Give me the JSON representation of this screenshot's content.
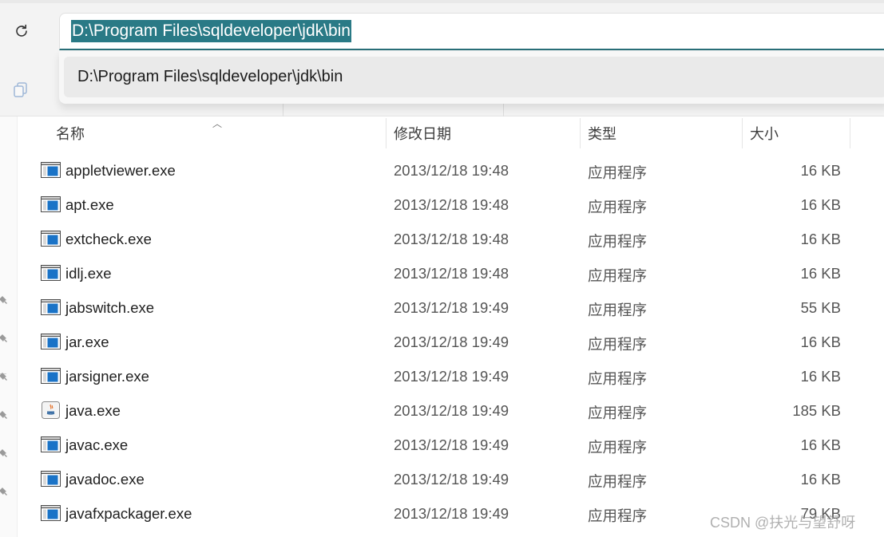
{
  "address_bar": {
    "value": "D:\\Program Files\\sqldeveloper\\jdk\\bin",
    "suggestion": "D:\\Program Files\\sqldeveloper\\jdk\\bin"
  },
  "icons": {
    "refresh": "refresh-icon",
    "copy": "copy-icon",
    "pin": "pin-icon",
    "exe": "exe-file-icon",
    "java": "java-file-icon"
  },
  "columns": {
    "name": "名称",
    "modified": "修改日期",
    "type": "类型",
    "size": "大小"
  },
  "files": [
    {
      "name": "appletviewer.exe",
      "date": "2013/12/18 19:48",
      "type": "应用程序",
      "size": "16 KB",
      "icon": "exe"
    },
    {
      "name": "apt.exe",
      "date": "2013/12/18 19:48",
      "type": "应用程序",
      "size": "16 KB",
      "icon": "exe"
    },
    {
      "name": "extcheck.exe",
      "date": "2013/12/18 19:48",
      "type": "应用程序",
      "size": "16 KB",
      "icon": "exe"
    },
    {
      "name": "idlj.exe",
      "date": "2013/12/18 19:48",
      "type": "应用程序",
      "size": "16 KB",
      "icon": "exe"
    },
    {
      "name": "jabswitch.exe",
      "date": "2013/12/18 19:49",
      "type": "应用程序",
      "size": "55 KB",
      "icon": "exe"
    },
    {
      "name": "jar.exe",
      "date": "2013/12/18 19:49",
      "type": "应用程序",
      "size": "16 KB",
      "icon": "exe"
    },
    {
      "name": "jarsigner.exe",
      "date": "2013/12/18 19:49",
      "type": "应用程序",
      "size": "16 KB",
      "icon": "exe"
    },
    {
      "name": "java.exe",
      "date": "2013/12/18 19:49",
      "type": "应用程序",
      "size": "185 KB",
      "icon": "java"
    },
    {
      "name": "javac.exe",
      "date": "2013/12/18 19:49",
      "type": "应用程序",
      "size": "16 KB",
      "icon": "exe"
    },
    {
      "name": "javadoc.exe",
      "date": "2013/12/18 19:49",
      "type": "应用程序",
      "size": "16 KB",
      "icon": "exe"
    },
    {
      "name": "javafxpackager.exe",
      "date": "2013/12/18 19:49",
      "type": "应用程序",
      "size": "79 KB",
      "icon": "exe"
    }
  ],
  "watermark": "CSDN @扶光与望舒呀",
  "colors": {
    "selection": "#2a7a86",
    "address_underline": "#2a6f78",
    "exe_icon_blue": "#1a73c7"
  }
}
